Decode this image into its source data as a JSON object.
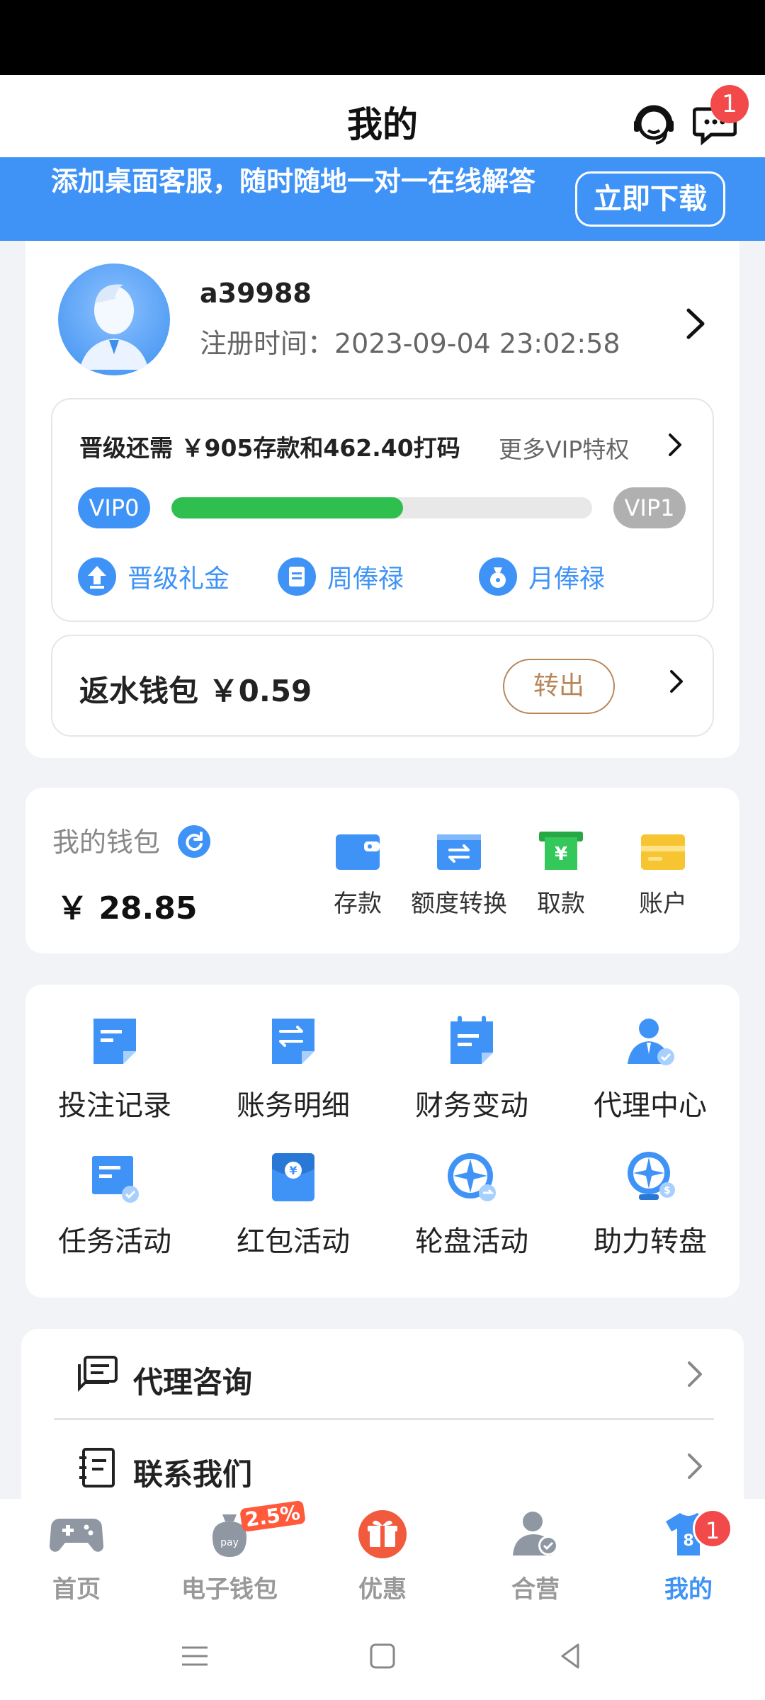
{
  "header": {
    "title": "我的",
    "message_badge": "1"
  },
  "banner": {
    "text": "添加桌面客服，随时随地一对一在线解答",
    "button": "立即下载"
  },
  "profile": {
    "username": "a39988",
    "register_time": "注册时间：2023-09-04 23:02:58"
  },
  "vip": {
    "need_text": "晋级还需 ￥905存款和462.40打码",
    "more_text": "更多VIP特权",
    "current_level": "VIP0",
    "next_level": "VIP1",
    "progress_fraction": 0.55,
    "perks": [
      {
        "label": "晋级礼金",
        "icon": "upgrade-arrow-icon"
      },
      {
        "label": "周俸禄",
        "icon": "clipboard-icon"
      },
      {
        "label": "月俸禄",
        "icon": "money-bag-icon"
      }
    ]
  },
  "rebate": {
    "label": "返水钱包 ￥0.59",
    "button": "转出"
  },
  "wallet": {
    "label": "我的钱包",
    "amount": "￥ 28.85",
    "actions": [
      {
        "label": "存款",
        "icon": "deposit-card-icon"
      },
      {
        "label": "额度转换",
        "icon": "transfer-icon"
      },
      {
        "label": "取款",
        "icon": "withdraw-atm-icon"
      },
      {
        "label": "账户",
        "icon": "account-card-icon"
      }
    ]
  },
  "grid": [
    {
      "label": "投注记录",
      "icon": "bet-record-icon"
    },
    {
      "label": "账务明细",
      "icon": "account-detail-icon"
    },
    {
      "label": "财务变动",
      "icon": "finance-change-icon"
    },
    {
      "label": "代理中心",
      "icon": "agent-center-icon"
    },
    {
      "label": "任务活动",
      "icon": "task-activity-icon"
    },
    {
      "label": "红包活动",
      "icon": "red-envelope-icon"
    },
    {
      "label": "轮盘活动",
      "icon": "roulette-icon"
    },
    {
      "label": "助力转盘",
      "icon": "prize-wheel-icon"
    }
  ],
  "list": [
    {
      "label": "代理咨询",
      "icon": "chat-icon"
    },
    {
      "label": "联系我们",
      "icon": "contact-icon"
    }
  ],
  "tabs": [
    {
      "label": "首页",
      "icon": "gamepad-icon"
    },
    {
      "label": "电子钱包",
      "icon": "pay-bag-icon",
      "badge": "2.5%"
    },
    {
      "label": "优惠",
      "icon": "gift-icon"
    },
    {
      "label": "合营",
      "icon": "partner-user-icon"
    },
    {
      "label": "我的",
      "icon": "shirt-icon",
      "badge": "1",
      "active": true
    }
  ],
  "colors": {
    "primary": "#3f93f7",
    "progress": "#2fbf4f",
    "badge": "#f24a4a",
    "rebate_btn": "#b8865a"
  }
}
